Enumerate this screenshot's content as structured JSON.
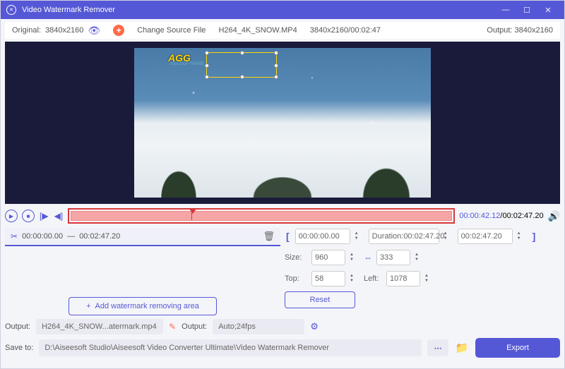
{
  "title": "Video Watermark Remover",
  "info": {
    "original_label": "Original:",
    "original_res": "3840x2160",
    "change_source": "Change Source File",
    "filename": "H264_4K_SNOW.MP4",
    "source_meta": "3840x2160/00:02:47",
    "output_label": "Output:",
    "output_res": "3840x2160"
  },
  "preview": {
    "logo_text": "AGG",
    "logo_sub": "AIGGSOFTWARE"
  },
  "playback": {
    "time_current": "00:00:42.12",
    "time_total": "/00:02:47.20"
  },
  "segment": {
    "start": "00:00:00.00",
    "dash": " — ",
    "end": "00:02:47.20"
  },
  "trim": {
    "start": "00:00:00.00",
    "duration_label": "Duration:",
    "duration": "00:02:47.20",
    "end": "00:02:47.20"
  },
  "box": {
    "size_label": "Size:",
    "width": "960",
    "height": "333",
    "top_label": "Top:",
    "top": "58",
    "left_label": "Left:",
    "left": "1078"
  },
  "buttons": {
    "add_area": "Add watermark removing area",
    "reset": "Reset",
    "export": "Export"
  },
  "output": {
    "label1": "Output:",
    "filename": "H264_4K_SNOW...atermark.mp4",
    "label2": "Output:",
    "format": "Auto;24fps"
  },
  "save": {
    "label": "Save to:",
    "path": "D:\\Aiseesoft Studio\\Aiseesoft Video Converter Ultimate\\Video Watermark Remover"
  }
}
